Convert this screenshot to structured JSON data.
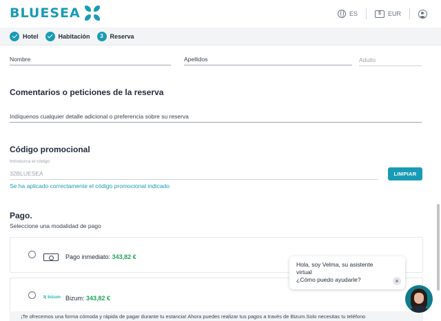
{
  "brand": {
    "name": "BLUESEA",
    "color": "#1a9bb5"
  },
  "header": {
    "language": "ES",
    "currency": "EUR"
  },
  "steps": [
    {
      "label": "Hotel",
      "state": "done"
    },
    {
      "label": "Habitación",
      "state": "done"
    },
    {
      "number": "3",
      "label": "Reserva",
      "state": "current"
    }
  ],
  "guest": {
    "first_name_placeholder": "Nombre",
    "last_name_placeholder": "Apellidos",
    "type_value": "Adulto"
  },
  "comments": {
    "title": "Comentarios o peticiones de la reserva",
    "placeholder": "Indíquenos cualquier detalle adicional o preferencia sobre su reserva"
  },
  "promo": {
    "title": "Código promocional",
    "field_label": "Introduzca el código",
    "value": "32BLUESEA",
    "clear_label": "LIMPIAR",
    "success_message": "Se ha aplicado correctamente el código promocional indicado"
  },
  "payment": {
    "title": "Pago.",
    "subtitle": "Seleccione una modalidad de pago",
    "options": [
      {
        "icon": "cash-icon",
        "label": "Pago inmediato:",
        "price": "343,82 €"
      },
      {
        "icon": "bizum-logo",
        "logo_text": "bizum",
        "label": "Bizum:",
        "price": "343,82 €"
      }
    ],
    "bizum_note": "¡Te ofrecemos una forma cómoda y rápida de pagar durante tu estancia! Ahora puedes realizar tus pagos a través de Bizum.Solo necesitas tu teléfono",
    "price_color": "#22a35a"
  },
  "chat": {
    "line1": "Hola, soy Velma, su asistente",
    "line2": "virtual",
    "line3": "¿Cómo puedo ayudarle?",
    "close_glyph": "×"
  }
}
